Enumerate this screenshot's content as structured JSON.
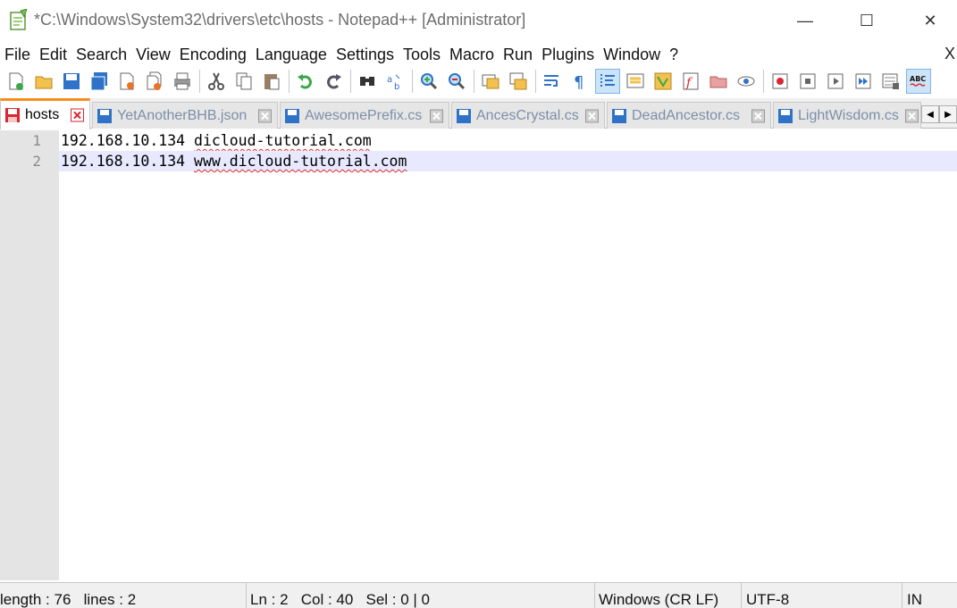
{
  "window": {
    "title": "*C:\\Windows\\System32\\drivers\\etc\\hosts - Notepad++ [Administrator]",
    "minimize_glyph": "—",
    "maximize_glyph": "☐",
    "close_glyph": "✕"
  },
  "menu": {
    "items": [
      "File",
      "Edit",
      "Search",
      "View",
      "Encoding",
      "Language",
      "Settings",
      "Tools",
      "Macro",
      "Run",
      "Plugins",
      "Window",
      "?"
    ],
    "close_label": "X"
  },
  "toolbar": {
    "icons": [
      "new-file-icon",
      "open-file-icon",
      "save-icon",
      "save-all-icon",
      "close-icon",
      "close-all-icon",
      "print-icon",
      "cut-icon",
      "copy-icon",
      "paste-icon",
      "undo-icon",
      "redo-icon",
      "find-icon",
      "replace-icon",
      "zoom-in-icon",
      "zoom-out-icon",
      "sync-vertical-icon",
      "sync-horizontal-icon",
      "word-wrap-icon",
      "show-all-chars-icon",
      "indent-guide-icon",
      "udl-icon",
      "doc-map-icon",
      "function-list-icon",
      "folder-workspace-icon",
      "monitoring-icon",
      "record-macro-icon",
      "stop-macro-icon",
      "play-macro-icon",
      "run-macro-multiple-icon",
      "save-macro-icon",
      "spell-check-icon"
    ],
    "spell_check_label": "ABC"
  },
  "tabs": [
    {
      "label": "hosts",
      "active": true,
      "modified": true
    },
    {
      "label": "YetAnotherBHB.json",
      "active": false,
      "modified": false
    },
    {
      "label": "AwesomePrefix.cs",
      "active": false,
      "modified": false
    },
    {
      "label": "AncesCrystal.cs",
      "active": false,
      "modified": false
    },
    {
      "label": "DeadAncestor.cs",
      "active": false,
      "modified": false
    },
    {
      "label": "LightWisdom.cs",
      "active": false,
      "modified": false
    }
  ],
  "tab_scroll": {
    "left": "◀",
    "right": "▶"
  },
  "editor": {
    "lines": [
      {
        "number": "1",
        "ip": "192.168.10.134 ",
        "host": "dicloud-tutorial.com",
        "current": false
      },
      {
        "number": "2",
        "ip": "192.168.10.134 ",
        "host": "www.dicloud-tutorial.com",
        "current": true
      }
    ]
  },
  "status": {
    "length": "length : 76",
    "lines": "lines : 2",
    "ln": "Ln : 2",
    "col": "Col : 40",
    "sel": "Sel : 0 | 0",
    "eol": "Windows (CR LF)",
    "encoding": "UTF-8",
    "mode": "IN"
  },
  "colors": {
    "active_tab_accent": "#fa8c1e",
    "current_line": "#e8e8ff",
    "gutter": "#e4e4e4",
    "modified_save": "#d9262f",
    "saved_blue": "#2e73c8"
  }
}
